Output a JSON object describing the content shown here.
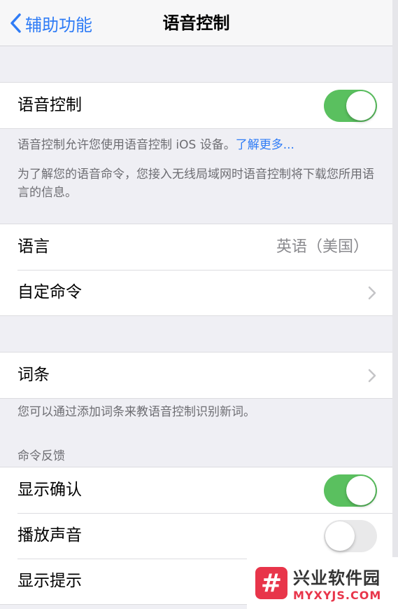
{
  "navbar": {
    "back_label": "辅助功能",
    "title": "语音控制"
  },
  "voice_control": {
    "label": "语音控制",
    "toggle_on": true
  },
  "voice_note": {
    "text": "语音控制允许您使用语音控制 iOS 设备。",
    "link": "了解更多...",
    "download_info": "为了解您的语音命令，您接入无线局域网时语音控制将下载您所用语言的信息。"
  },
  "settings": {
    "language_label": "语言",
    "language_value": "英语（美国）",
    "custom_commands_label": "自定命令"
  },
  "vocabulary": {
    "label": "词条",
    "note": "您可以通过添加词条来教语音控制识别新词。"
  },
  "command_feedback": {
    "header": "命令反馈",
    "show_confirmation_label": "显示确认",
    "show_confirmation_on": true,
    "play_sound_label": "播放声音",
    "play_sound_on": false,
    "show_hints_label": "显示提示"
  },
  "watermark": {
    "logo_glyph": "#",
    "name": "兴业软件园",
    "url": "MYXYJS.COM"
  },
  "colors": {
    "accent_blue": "#2f7cf6",
    "toggle_green": "#5ac05f",
    "watermark_red": "#e8354a"
  }
}
